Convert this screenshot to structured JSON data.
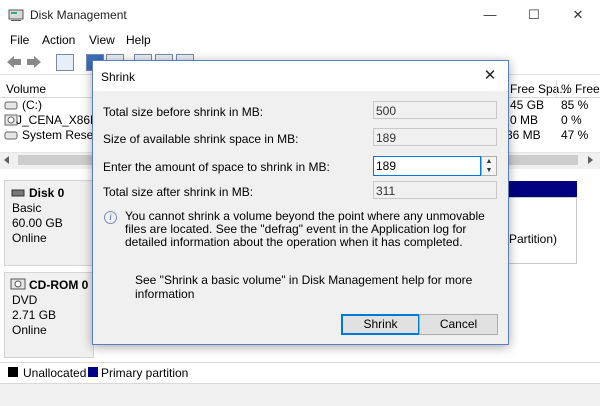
{
  "window": {
    "title": "Disk Management",
    "minimize": "—",
    "maximize": "☐",
    "close": "✕"
  },
  "menu": [
    "File",
    "Action",
    "View",
    "Help"
  ],
  "volume_list": {
    "columns": [
      "Volume",
      "Free Spa...",
      "% Free"
    ],
    "rows": [
      {
        "name": "(C:)",
        "free": "0.45 GB",
        "pct": "85 %"
      },
      {
        "name": "J_CENA_X86FR",
        "free": "0 MB",
        "pct": "0 %"
      },
      {
        "name": "System Reserv",
        "free": "36 MB",
        "pct": "47 %"
      }
    ]
  },
  "disks": [
    {
      "name": "Disk 0",
      "type": "Basic",
      "size": "60.00 GB",
      "status": "Online",
      "partition_text": "Partition)"
    },
    {
      "name": "CD-ROM 0",
      "type": "DVD",
      "size": "2.71 GB",
      "status": "Online"
    }
  ],
  "legend": [
    {
      "label": "Unallocated",
      "color": "#000000"
    },
    {
      "label": "Primary partition",
      "color": "#000080"
    }
  ],
  "dialog": {
    "title": "Shrink",
    "total_before_label": "Total size before shrink in MB:",
    "total_before_value": "500",
    "available_label": "Size of available shrink space in MB:",
    "available_value": "189",
    "amount_label": "Enter the amount of space to shrink in MB:",
    "amount_value": "189",
    "total_after_label": "Total size after shrink in MB:",
    "total_after_value": "311",
    "note": "You cannot shrink a volume beyond the point where any unmovable files are located. See the \"defrag\" event in the Application log for detailed information about the operation when it has completed.",
    "help": "See \"Shrink a basic volume\" in Disk Management help for more information",
    "shrink_button": "Shrink",
    "cancel_button": "Cancel"
  },
  "colors": {
    "accent": "#0078d7",
    "dialog_bg": "#f0f0f0",
    "partition_bar": "#000080"
  }
}
